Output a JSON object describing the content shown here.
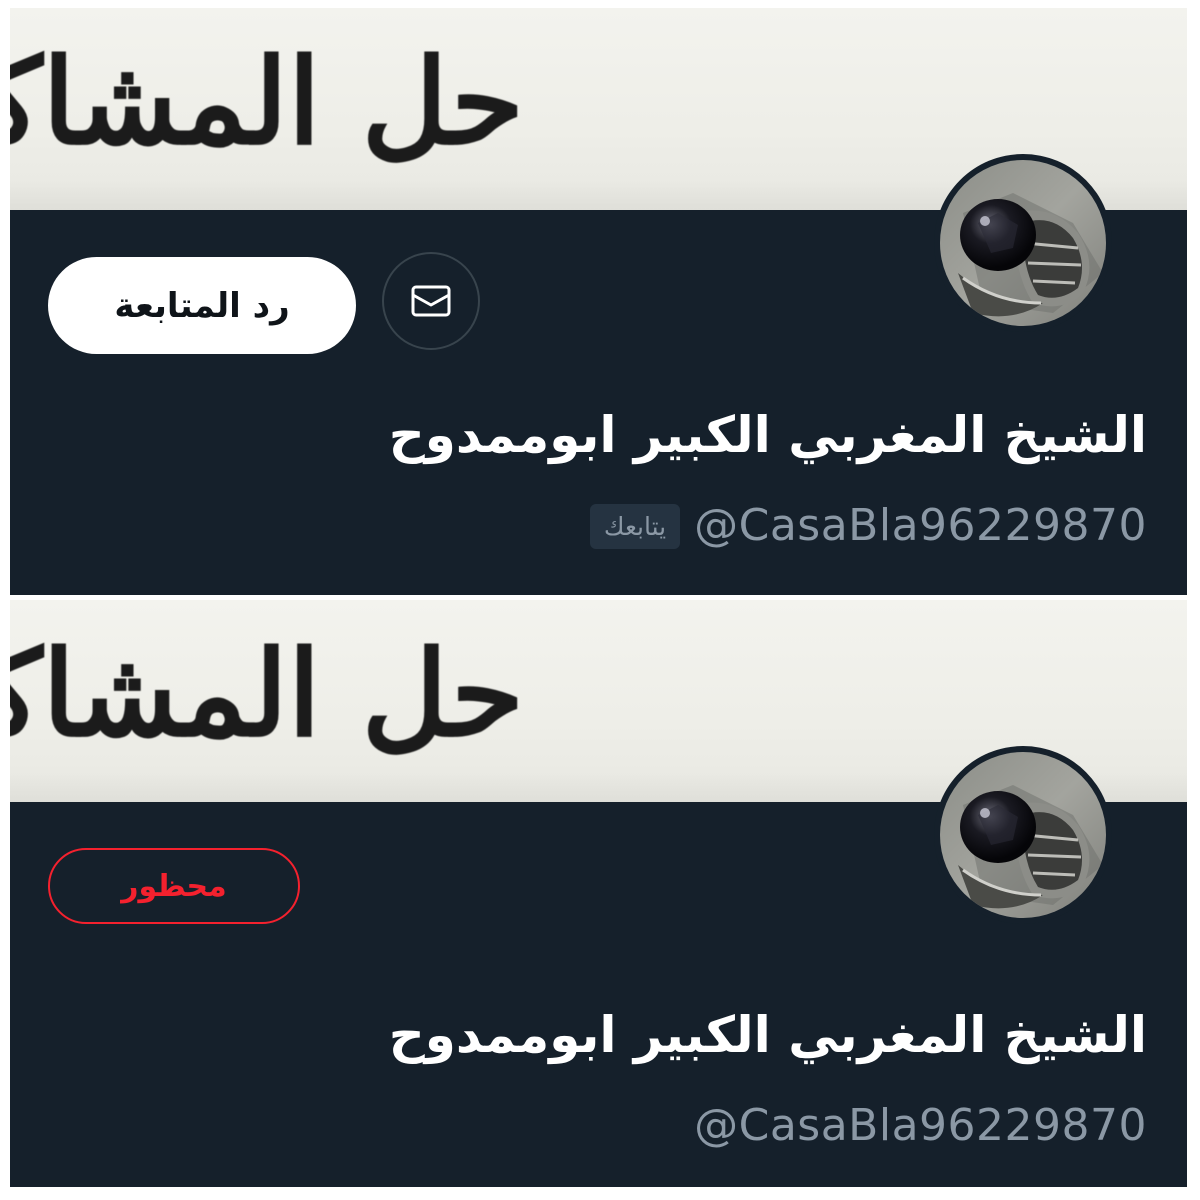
{
  "banner": {
    "text": "حل المشاكل الزوجيه"
  },
  "top_profile": {
    "display_name": "الشيخ المغربي الكبير ابوممدوح",
    "handle": "@CasaBla96229870",
    "follows_you_badge": "يتابعك",
    "follow_back_label": "رد المتابعة",
    "message_icon": "mail-icon"
  },
  "bottom_profile": {
    "display_name": "الشيخ المغربي الكبير ابوممدوح",
    "handle": "@CasaBla96229870",
    "blocked_label": "محظور"
  },
  "colors": {
    "background": "#15202b",
    "handle_gray": "#8b98a5",
    "blocked_red": "#f4212e",
    "button_white": "#ffffff"
  }
}
